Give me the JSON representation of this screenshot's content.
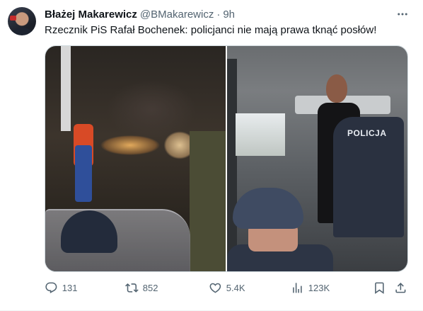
{
  "tweet": {
    "author_name": "Błażej Makarewicz",
    "author_handle": "@BMakarewicz",
    "separator": "·",
    "time": "9h",
    "text": "Rzecznik PiS Rafał Bochenek: policjanci nie mają prawa tknąć posłów!",
    "media": [
      {
        "kind": "photo",
        "position": "left"
      },
      {
        "kind": "photo",
        "position": "right",
        "visible_text": "POLICJA"
      }
    ]
  },
  "actions": {
    "reply_count": "131",
    "retweet_count": "852",
    "like_count": "5.4K",
    "views_count": "123K"
  },
  "icons": {
    "more": "more-horizontal-icon",
    "reply": "reply-icon",
    "retweet": "retweet-icon",
    "like": "heart-icon",
    "views": "analytics-icon",
    "bookmark": "bookmark-icon",
    "share": "share-icon"
  },
  "colors": {
    "text_primary": "#0f1419",
    "text_secondary": "#536471",
    "border": "#cfd9de"
  }
}
